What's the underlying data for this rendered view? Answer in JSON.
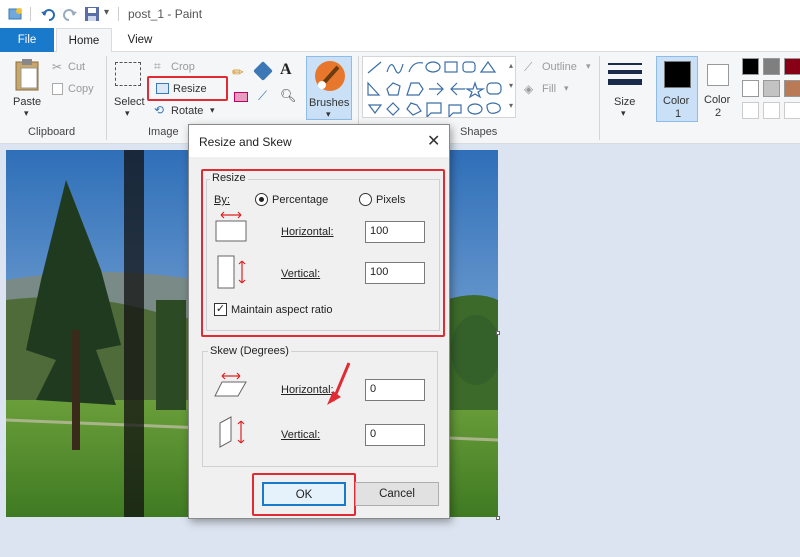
{
  "window": {
    "title": "post_1 - Paint"
  },
  "tabs": {
    "file": "File",
    "home": "Home",
    "view": "View"
  },
  "ribbon": {
    "clipboard": {
      "paste": "Paste",
      "cut": "Cut",
      "copy": "Copy",
      "group": "Clipboard"
    },
    "image": {
      "select": "Select",
      "crop": "Crop",
      "resize": "Resize",
      "rotate": "Rotate",
      "group": "Image"
    },
    "tools": {
      "brushes": "Brushes"
    },
    "shapes": {
      "outline": "Outline",
      "fill": "Fill",
      "group": "Shapes"
    },
    "size": "Size",
    "color1": "Color\n1",
    "color1_a": "Color",
    "color1_b": "1",
    "color2_a": "Color",
    "color2_b": "2",
    "palette": [
      "#000000",
      "#7f7f7f",
      "#880015",
      "#ffffff",
      "#c3c3c3",
      "#b97a57"
    ]
  },
  "dialog": {
    "title": "Resize and Skew",
    "resize": {
      "legend": "Resize",
      "by": "By:",
      "percentage": "Percentage",
      "pixels": "Pixels",
      "horizontal_label": "Horizontal:",
      "horizontal_value": "100",
      "vertical_label": "Vertical:",
      "vertical_value": "100",
      "maintain": "Maintain aspect ratio"
    },
    "skew": {
      "legend": "Skew (Degrees)",
      "horizontal_label": "Horizontal:",
      "horizontal_value": "0",
      "vertical_label": "Vertical:",
      "vertical_value": "0"
    },
    "ok": "OK",
    "cancel": "Cancel"
  },
  "colors": {
    "accent": "#1979ca",
    "highlight": "#e02b35"
  }
}
